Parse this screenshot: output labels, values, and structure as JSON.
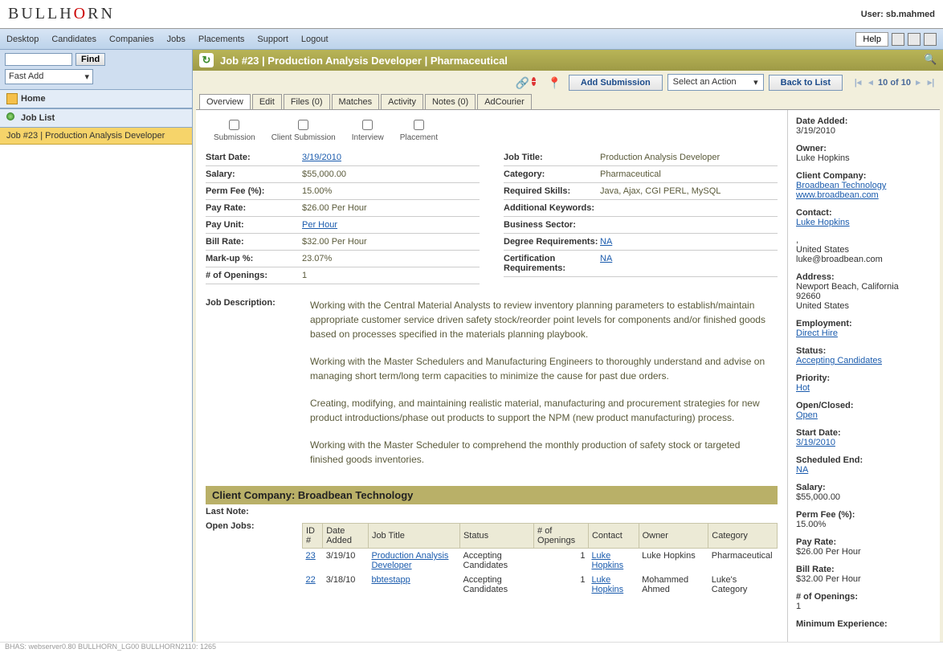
{
  "header": {
    "user_label": "User: sb.mahmed"
  },
  "menu": {
    "items": [
      "Desktop",
      "Candidates",
      "Companies",
      "Jobs",
      "Placements",
      "Support",
      "Logout"
    ],
    "help": "Help"
  },
  "sidebar": {
    "find": "Find",
    "fastadd": "Fast Add",
    "home": "Home",
    "joblist": "Job List",
    "openTab": "Job #23 | Production Analysis Developer"
  },
  "page": {
    "title": "Job #23 | Production Analysis Developer | Pharmaceutical",
    "addSubmission": "Add Submission",
    "selectAction": "Select an Action",
    "backToList": "Back to List",
    "pager": "10 of 10"
  },
  "tabs": [
    "Overview",
    "Edit",
    "Files (0)",
    "Matches",
    "Activity",
    "Notes (0)",
    "AdCourier"
  ],
  "steps": [
    "Submission",
    "Client Submission",
    "Interview",
    "Placement"
  ],
  "details": {
    "left": [
      {
        "label": "Start Date:",
        "value": "3/19/2010",
        "link": true
      },
      {
        "label": "Salary:",
        "value": "$55,000.00"
      },
      {
        "label": "Perm Fee (%):",
        "value": "15.00%"
      },
      {
        "label": "Pay Rate:",
        "value": "$26.00 Per Hour"
      },
      {
        "label": "Pay Unit:",
        "value": "Per Hour",
        "link": true
      },
      {
        "label": "Bill Rate:",
        "value": "$32.00 Per Hour"
      },
      {
        "label": "Mark-up %:",
        "value": "23.07%"
      },
      {
        "label": "# of Openings:",
        "value": "1"
      }
    ],
    "right": [
      {
        "label": "Job Title:",
        "value": "Production Analysis Developer"
      },
      {
        "label": "Category:",
        "value": "Pharmaceutical"
      },
      {
        "label": "Required Skills:",
        "value": "Java, Ajax, CGI PERL, MySQL"
      },
      {
        "label": "Additional Keywords:",
        "value": ""
      },
      {
        "label": "Business Sector:",
        "value": ""
      },
      {
        "label": "Degree Requirements:",
        "value": "NA",
        "link": true
      },
      {
        "label": "Certification Requirements:",
        "value": "NA",
        "link": true
      }
    ]
  },
  "descLabel": "Job Description:",
  "desc": {
    "p1": "Working with the Central Material Analysts to review inventory planning parameters to establish/maintain appropriate customer service driven safety stock/reorder point levels for components and/or finished goods based on processes specified in the materials planning playbook.",
    "p2": "Working with the Master Schedulers and Manufacturing Engineers to thoroughly understand and advise on managing short term/long term capacities to minimize the cause for past due orders.",
    "p3": "Creating, modifying, and maintaining realistic material, manufacturing and procurement strategies for new product introductions/phase out products to support the NPM (new product manufacturing) process.",
    "p4": "Working with the Master Scheduler to comprehend the monthly production of safety stock or targeted finished goods inventories."
  },
  "clientSection": {
    "header": "Client Company: Broadbean Technology",
    "lastNote": "Last Note:",
    "openJobs": "Open Jobs:",
    "cols": [
      "ID #",
      "Date Added",
      "Job Title",
      "Status",
      "# of Openings",
      "Contact",
      "Owner",
      "Category"
    ],
    "rows": [
      {
        "id": "23",
        "date": "3/19/10",
        "title": "Production Analysis Developer",
        "status": "Accepting Candidates",
        "openings": "1",
        "contact": "Luke Hopkins",
        "owner": "Luke Hopkins",
        "category": "Pharmaceutical"
      },
      {
        "id": "22",
        "date": "3/18/10",
        "title": "bbtestapp",
        "status": "Accepting Candidates",
        "openings": "1",
        "contact": "Luke Hopkins",
        "owner": "Mohammed Ahmed",
        "category": "Luke's Category"
      }
    ]
  },
  "info": {
    "dateAdded": {
      "l": "Date Added:",
      "v": "3/19/2010"
    },
    "owner": {
      "l": "Owner:",
      "v": "Luke Hopkins"
    },
    "clientCompany": {
      "l": "Client Company:",
      "v": "Broadbean Technology",
      "v2": "www.broadbean.com"
    },
    "contact": {
      "l": "Contact:",
      "v": "Luke Hopkins"
    },
    "contactExtra": [
      ",",
      "United States",
      "luke@broadbean.com"
    ],
    "address": {
      "l": "Address:",
      "lines": [
        "Newport Beach, California",
        "92660",
        "United States"
      ]
    },
    "employment": {
      "l": "Employment:",
      "v": "Direct Hire"
    },
    "status": {
      "l": "Status:",
      "v": "Accepting Candidates"
    },
    "priority": {
      "l": "Priority:",
      "v": "Hot"
    },
    "openclosed": {
      "l": "Open/Closed:",
      "v": "Open"
    },
    "startdate": {
      "l": "Start Date:",
      "v": "3/19/2010"
    },
    "schedend": {
      "l": "Scheduled End:",
      "v": "NA"
    },
    "salary": {
      "l": "Salary:",
      "v": "$55,000.00"
    },
    "permfee": {
      "l": "Perm Fee (%):",
      "v": "15.00%"
    },
    "payrate": {
      "l": "Pay Rate:",
      "v": "$26.00 Per Hour"
    },
    "billrate": {
      "l": "Bill Rate:",
      "v": "$32.00 Per Hour"
    },
    "numopen": {
      "l": "# of Openings:",
      "v": "1"
    },
    "minexp": {
      "l": "Minimum Experience:"
    }
  },
  "footer": "BHAS: webserver0.80 BULLHORN_LG00 BULLHORN2110: 1265"
}
